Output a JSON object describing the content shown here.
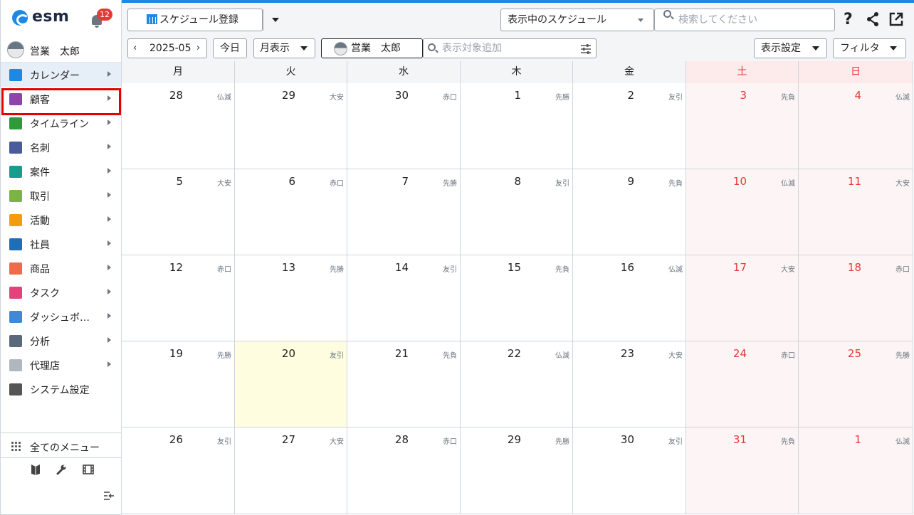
{
  "sidebar": {
    "logo_text": "esm",
    "notification_count": "12",
    "user_name": "営業　太郎",
    "items": [
      {
        "label": "カレンダー",
        "icon": "calendar-icon",
        "color": "#1e88e5",
        "active": true
      },
      {
        "label": "顧客",
        "icon": "building-icon",
        "color": "#8e44ad",
        "active": false
      },
      {
        "label": "タイムライン",
        "icon": "chat-icon",
        "color": "#2e9b3a",
        "active": false
      },
      {
        "label": "名刺",
        "icon": "card-icon",
        "color": "#4a5a9c",
        "active": false
      },
      {
        "label": "案件",
        "icon": "folder-icon",
        "color": "#1a9c8c",
        "active": false
      },
      {
        "label": "取引",
        "icon": "deal-icon",
        "color": "#7cb342",
        "active": false
      },
      {
        "label": "活動",
        "icon": "clipboard-icon",
        "color": "#f39c12",
        "active": false
      },
      {
        "label": "社員",
        "icon": "person-icon",
        "color": "#1e6fb8",
        "active": false
      },
      {
        "label": "商品",
        "icon": "box-icon",
        "color": "#ef6c4a",
        "active": false
      },
      {
        "label": "タスク",
        "icon": "check-icon",
        "color": "#e0447a",
        "active": false
      },
      {
        "label": "ダッシュボ…",
        "icon": "dashboard-icon",
        "color": "#3f8ad8",
        "active": false
      },
      {
        "label": "分析",
        "icon": "chart-icon",
        "color": "#5a6a7a",
        "active": false
      },
      {
        "label": "代理店",
        "icon": "document-icon",
        "color": "#b0b7bf",
        "active": false
      },
      {
        "label": "システム設定",
        "icon": "gear-icon",
        "color": "#555555",
        "active": false
      }
    ],
    "all_menu_label": "全てのメニュー"
  },
  "toolbar": {
    "register_label": "スケジュール登録",
    "schedule_select": "表示中のスケジュール",
    "search_placeholder": "検索してください",
    "month_label": "2025-05",
    "today_label": "今日",
    "view_label": "月表示",
    "user_chip": "営業　太郎",
    "add_target_placeholder": "表示対象追加",
    "display_settings_label": "表示設定",
    "filter_label": "フィルタ"
  },
  "calendar": {
    "weekdays": [
      "月",
      "火",
      "水",
      "木",
      "金",
      "土",
      "日"
    ],
    "weeks": [
      [
        [
          "28",
          "仏滅"
        ],
        [
          "29",
          "大安"
        ],
        [
          "30",
          "赤口"
        ],
        [
          "1",
          "先勝"
        ],
        [
          "2",
          "友引"
        ],
        [
          "3",
          "先負"
        ],
        [
          "4",
          "仏滅"
        ]
      ],
      [
        [
          "5",
          "大安"
        ],
        [
          "6",
          "赤口"
        ],
        [
          "7",
          "先勝"
        ],
        [
          "8",
          "友引"
        ],
        [
          "9",
          "先負"
        ],
        [
          "10",
          "仏滅"
        ],
        [
          "11",
          "大安"
        ]
      ],
      [
        [
          "12",
          "赤口"
        ],
        [
          "13",
          "先勝"
        ],
        [
          "14",
          "友引"
        ],
        [
          "15",
          "先負"
        ],
        [
          "16",
          "仏滅"
        ],
        [
          "17",
          "大安"
        ],
        [
          "18",
          "赤口"
        ]
      ],
      [
        [
          "19",
          "先勝"
        ],
        [
          "20",
          "友引"
        ],
        [
          "21",
          "先負"
        ],
        [
          "22",
          "仏滅"
        ],
        [
          "23",
          "大安"
        ],
        [
          "24",
          "赤口"
        ],
        [
          "25",
          "先勝"
        ]
      ],
      [
        [
          "26",
          "友引"
        ],
        [
          "27",
          "大安"
        ],
        [
          "28",
          "赤口"
        ],
        [
          "29",
          "先勝"
        ],
        [
          "30",
          "友引"
        ],
        [
          "31",
          "先負"
        ],
        [
          "1",
          "仏滅"
        ]
      ]
    ],
    "today_week": 3,
    "today_day": 1
  }
}
